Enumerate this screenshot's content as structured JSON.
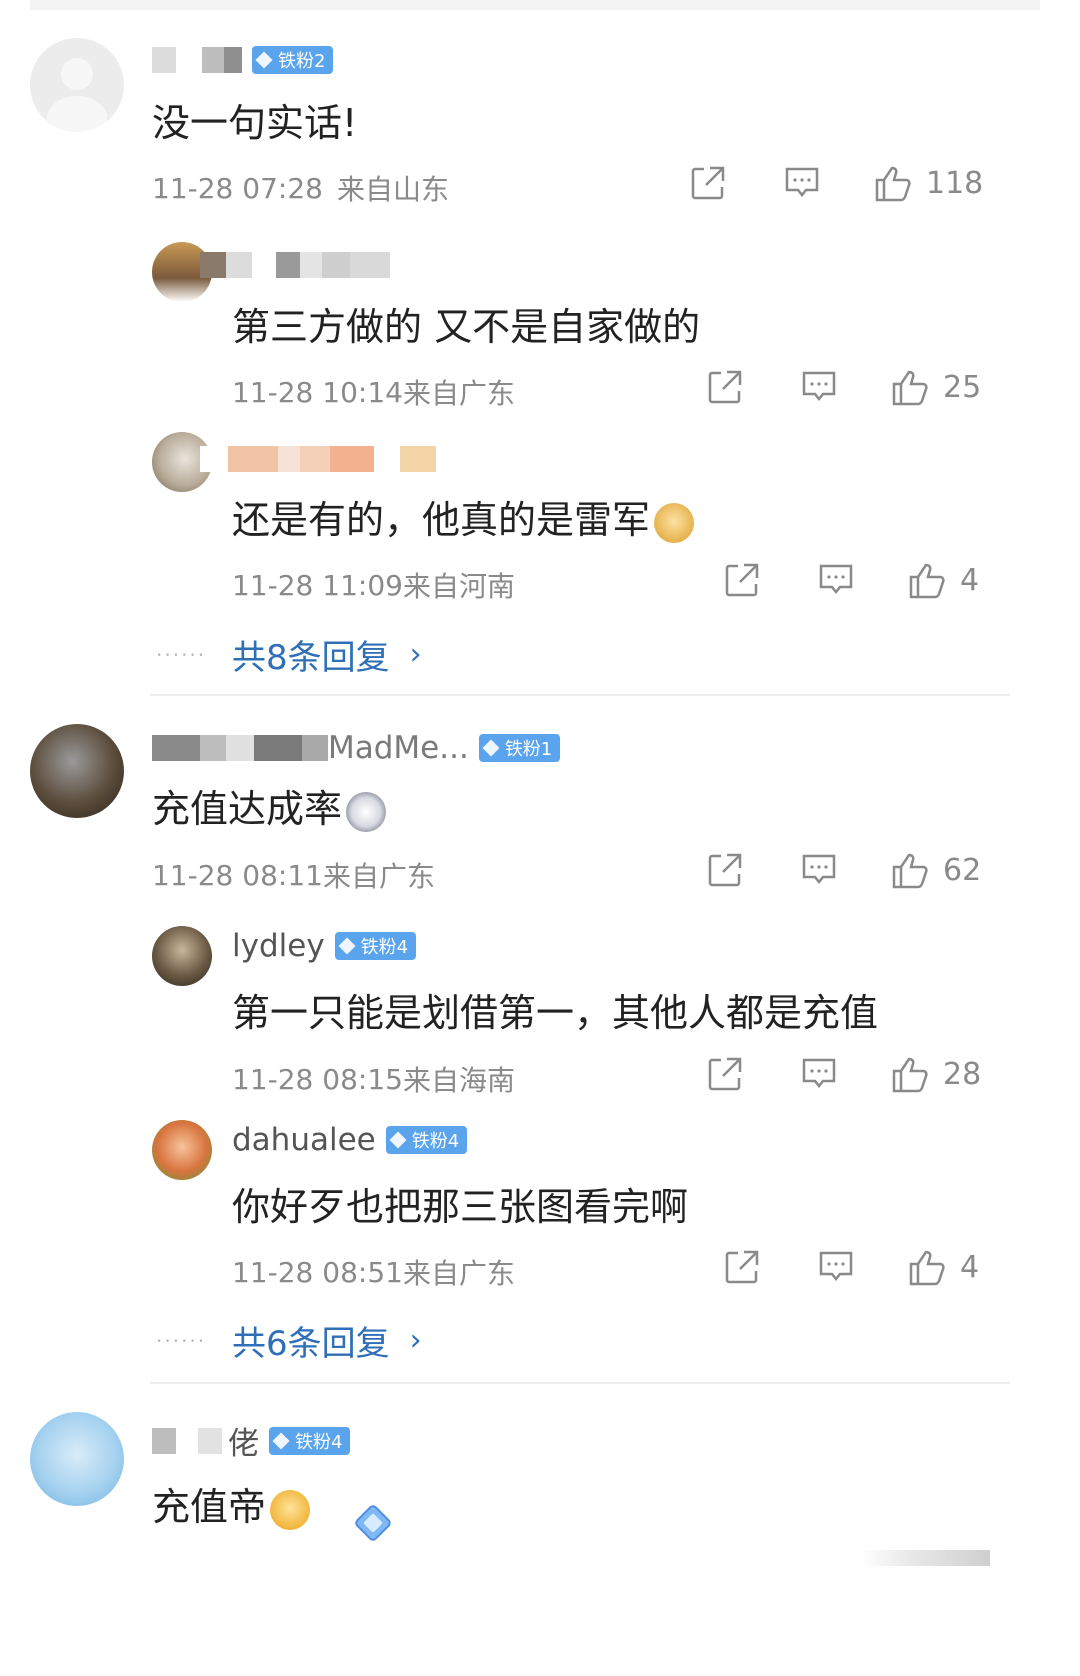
{
  "comments": [
    {
      "badge": "铁粉2",
      "text": "没一句实话!",
      "time": "11-28 07:28",
      "location": "来自山东",
      "likes": "118"
    },
    {
      "badge": "铁粉1",
      "name_partial": "MadMe...",
      "text": "充值达成率",
      "time": "11-28 08:11",
      "location": "来自广东",
      "likes": "62"
    },
    {
      "badge": "铁粉4",
      "name_partial": "佬",
      "text": "充值帝"
    }
  ],
  "replies_group1": [
    {
      "text": "第三方做的 又不是自家做的",
      "time": "11-28 10:14",
      "location": "来自广东",
      "likes": "25"
    },
    {
      "text": "还是有的，他真的是雷军",
      "time": "11-28 11:09",
      "location": "来自河南",
      "likes": "4"
    }
  ],
  "more_group1": "共8条回复",
  "replies_group2": [
    {
      "name": "lydley",
      "badge": "铁粉4",
      "text": "第一只能是划借第一，其他人都是充值",
      "time": "11-28 08:15",
      "location": "来自海南",
      "likes": "28"
    },
    {
      "name": "dahualee",
      "badge": "铁粉4",
      "text": "你好歹也把那三张图看完啊",
      "time": "11-28 08:51",
      "location": "来自广东",
      "likes": "4"
    }
  ],
  "more_group2": "共6条回复",
  "icons": {
    "share": "share-icon",
    "reply": "comment-icon",
    "like": "thumbs-up-icon"
  },
  "colors": {
    "link": "#2e6fb8",
    "badge": "#5aa4ee",
    "meta": "#8a8a8a"
  }
}
